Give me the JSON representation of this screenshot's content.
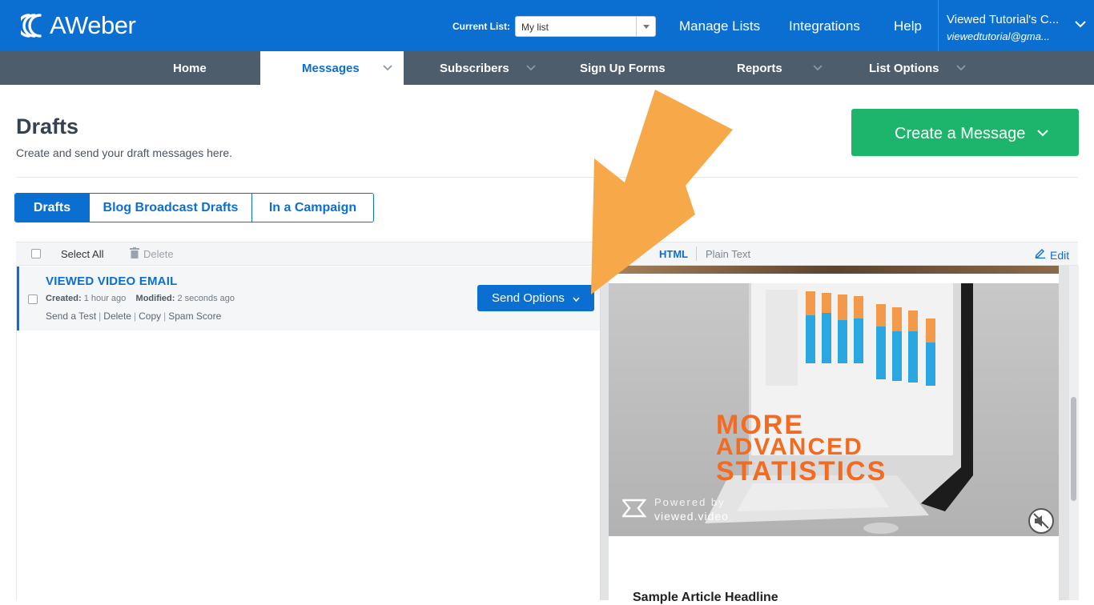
{
  "header": {
    "logo_text": "AWeber",
    "current_list_label": "Current List:",
    "current_list_value": "My list",
    "nav": [
      {
        "label": "Manage Lists"
      },
      {
        "label": "Integrations"
      },
      {
        "label": "Help"
      }
    ],
    "account_name": "Viewed Tutorial's C...",
    "account_email": "viewedtutorial@gma..."
  },
  "main_nav": [
    {
      "label": "Home",
      "has_dropdown": false,
      "active": false
    },
    {
      "label": "Messages",
      "has_dropdown": true,
      "active": true
    },
    {
      "label": "Subscribers",
      "has_dropdown": true,
      "active": false
    },
    {
      "label": "Sign Up Forms",
      "has_dropdown": false,
      "active": false
    },
    {
      "label": "Reports",
      "has_dropdown": true,
      "active": false
    },
    {
      "label": "List Options",
      "has_dropdown": true,
      "active": false
    }
  ],
  "page": {
    "title": "Drafts",
    "subtitle": "Create and send your draft messages here.",
    "create_button": "Create a Message"
  },
  "tabs": [
    {
      "label": "Drafts",
      "active": true
    },
    {
      "label": "Blog Broadcast Drafts",
      "active": false
    },
    {
      "label": "In a Campaign",
      "active": false
    }
  ],
  "toolbar": {
    "select_all": "Select All",
    "delete": "Delete",
    "view_html": "HTML",
    "view_plain": "Plain Text",
    "edit": "Edit"
  },
  "messages": [
    {
      "title": "VIEWED VIDEO EMAIL",
      "created_label": "Created:",
      "created_value": "1 hour ago",
      "modified_label": "Modified:",
      "modified_value": "2 seconds ago",
      "actions": [
        "Send a Test",
        "Delete",
        "Copy",
        "Spam Score"
      ],
      "send_button": "Send Options"
    }
  ],
  "preview": {
    "video_text_line1": "MORE",
    "video_text_line2": "ADVANCED",
    "video_text_line3": "STATISTICS",
    "powered_by": "Powered by",
    "powered_url": "viewed.video",
    "headline": "Sample Article Headline"
  },
  "colors": {
    "brand_blue": "#0b6fd1",
    "nav_gray": "#4d5d6b",
    "create_green": "#1cb56b",
    "arrow_orange": "#f7a94a",
    "video_orange": "#f26b21"
  },
  "icons": [
    "aweber-logo-icon",
    "chevron-down-icon",
    "trash-icon",
    "pencil-icon",
    "mute-icon",
    "viewed-logo-icon",
    "arrow-annotation-icon"
  ]
}
